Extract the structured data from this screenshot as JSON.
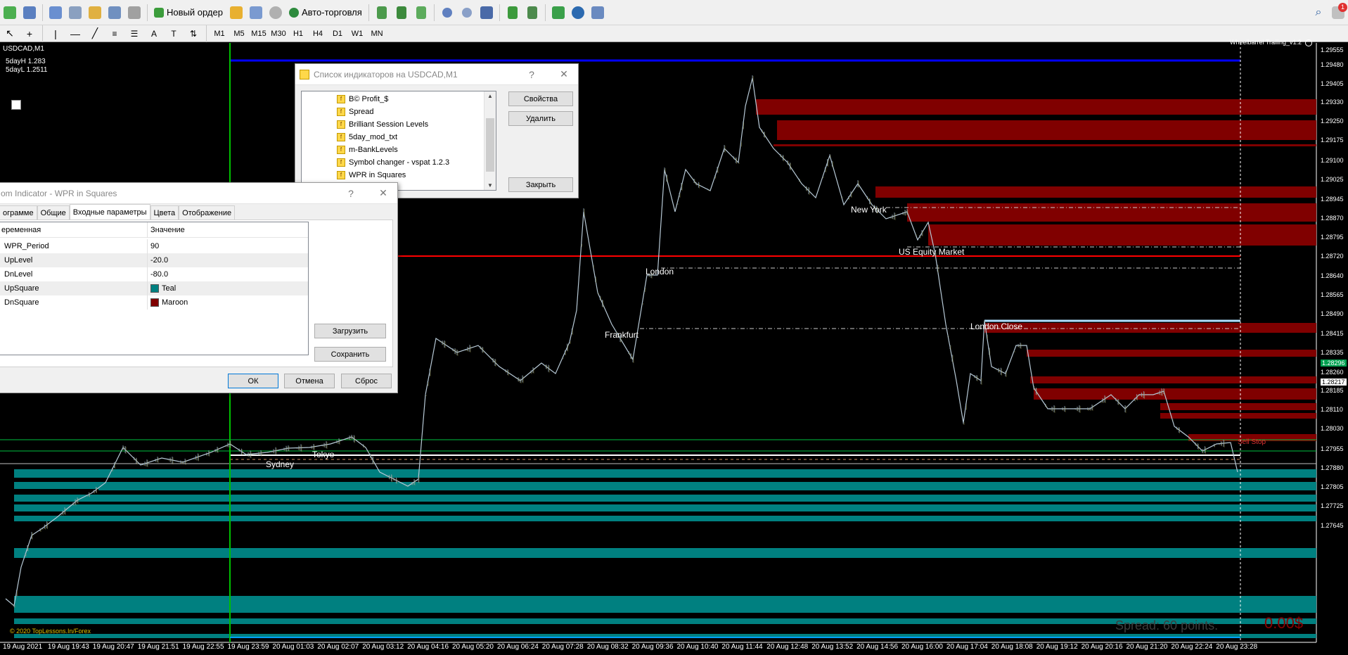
{
  "toolbar": {
    "new_order": "Новый ордер",
    "auto_trading": "Авто-торговля",
    "timeframes": [
      "M1",
      "M5",
      "M15",
      "M30",
      "H1",
      "H4",
      "D1",
      "W1",
      "MN"
    ],
    "notification_count": "1"
  },
  "chart": {
    "symbol": "USDCAD,M1",
    "ea_name": "Wheelbarrel Trailing_v1.2",
    "info_lines": [
      "5dayH 1.283",
      "5dayL 1.2511"
    ],
    "copyright": "© 2020 TopLessons.In/Forex",
    "spread_text": "Spread: 60 points.",
    "profit_text": "0.00$",
    "sell_stop_label": "Sell Stop",
    "sessions": [
      "Sydney",
      "Tokyo",
      "London",
      "Frankfurt",
      "New York",
      "US Equity Market",
      "London Close"
    ],
    "price_axis": [
      "1.29555",
      "1.29480",
      "1.29405",
      "1.29330",
      "1.29250",
      "1.29175",
      "1.29100",
      "1.29025",
      "1.28945",
      "1.28870",
      "1.28795",
      "1.28720",
      "1.28640",
      "1.28565",
      "1.28490",
      "1.28415",
      "1.28335",
      "1.28296",
      "1.28260",
      "1.28217",
      "1.28185",
      "1.28110",
      "1.28030",
      "1.27955",
      "1.27880",
      "1.27805",
      "1.27725",
      "1.27645"
    ],
    "time_axis": [
      "19 Aug 2021",
      "19 Aug 19:43",
      "19 Aug 20:47",
      "19 Aug 21:51",
      "19 Aug 22:55",
      "19 Aug 23:59",
      "20 Aug 01:03",
      "20 Aug 02:07",
      "20 Aug 03:12",
      "20 Aug 04:16",
      "20 Aug 05:20",
      "20 Aug 06:24",
      "20 Aug 07:28",
      "20 Aug 08:32",
      "20 Aug 09:36",
      "20 Aug 10:40",
      "20 Aug 11:44",
      "20 Aug 12:48",
      "20 Aug 13:52",
      "20 Aug 14:56",
      "20 Aug 16:00",
      "20 Aug 17:04",
      "20 Aug 18:08",
      "20 Aug 19:12",
      "20 Aug 20:16",
      "20 Aug 21:20",
      "20 Aug 22:24",
      "20 Aug 23:28"
    ],
    "colors": {
      "up_square": "#008080",
      "dn_square": "#800000",
      "price_line": "#b7c9d6"
    }
  },
  "indicator_list": {
    "title": "Список индикаторов на USDCAD,M1",
    "help": "?",
    "items": [
      "B© Profit_$",
      "Spread",
      "Brilliant Session Levels",
      "5day_mod_txt",
      "m-BankLevels",
      "Symbol changer - vspat 1.2.3",
      "WPR in Squares"
    ],
    "btn_properties": "Свойства",
    "btn_delete": "Удалить",
    "btn_close": "Закрыть"
  },
  "params_dialog": {
    "title": "om Indicator - WPR in Squares",
    "help": "?",
    "tabs": [
      "ограмме",
      "Общие",
      "Входные параметры",
      "Цвета",
      "Отображение"
    ],
    "col_variable": "еременная",
    "col_value": "Значение",
    "rows": [
      {
        "name": "WPR_Period",
        "value": "90"
      },
      {
        "name": "UpLevel",
        "value": "-20.0"
      },
      {
        "name": "DnLevel",
        "value": "-80.0"
      },
      {
        "name": "UpSquare",
        "value": "Teal"
      },
      {
        "name": "DnSquare",
        "value": "Maroon"
      }
    ],
    "btn_load": "Загрузить",
    "btn_save": "Сохранить",
    "btn_ok": "ОК",
    "btn_cancel": "Отмена",
    "btn_reset": "Сброс"
  }
}
